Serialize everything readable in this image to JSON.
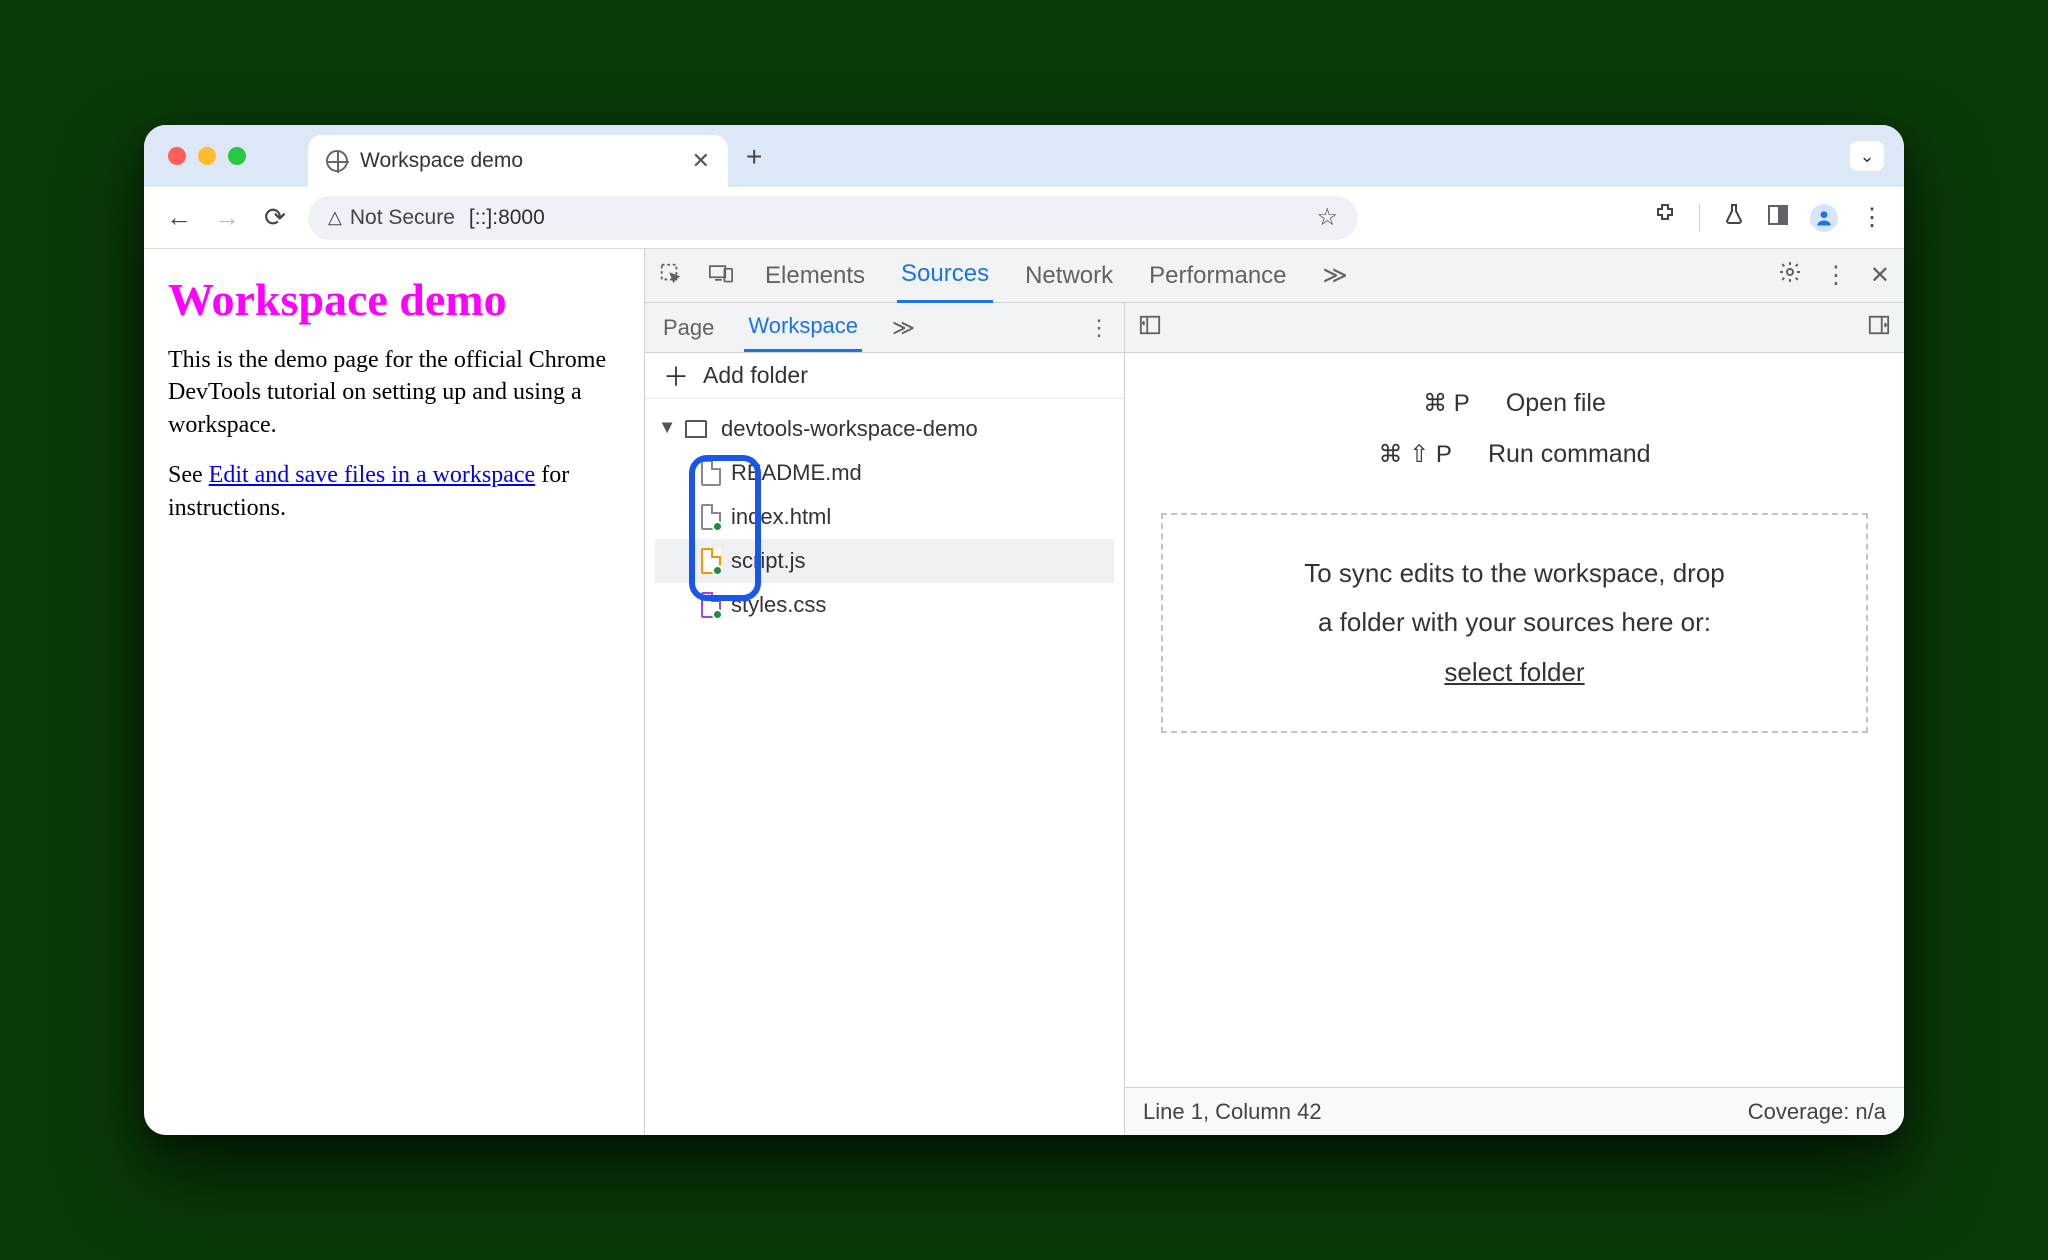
{
  "browser": {
    "tab_title": "Workspace demo",
    "new_tab_label": "+",
    "nav": {
      "back": "←",
      "forward": "→",
      "reload": "⟳"
    },
    "omnibox": {
      "not_secure_label": "Not Secure",
      "url": "[::]:8000"
    },
    "toolbar": {
      "extensions": "⧩",
      "labs": "⚗",
      "panel": "◨",
      "menu": "⋮"
    }
  },
  "page": {
    "heading": "Workspace demo",
    "p1": "This is the demo page for the official Chrome DevTools tutorial on setting up and using a workspace.",
    "p2_prefix": "See ",
    "p2_link": "Edit and save files in a workspace",
    "p2_suffix": " for instructions."
  },
  "devtools": {
    "tabs": {
      "elements": "Elements",
      "sources": "Sources",
      "network": "Network",
      "performance": "Performance",
      "more": "≫"
    },
    "sources": {
      "subtabs": {
        "page": "Page",
        "workspace": "Workspace",
        "more": "≫"
      },
      "add_folder": "Add folder",
      "tree": {
        "root": "devtools-workspace-demo",
        "files": [
          {
            "name": "README.md",
            "icon": "gray",
            "mapped": false
          },
          {
            "name": "index.html",
            "icon": "gray",
            "mapped": true
          },
          {
            "name": "script.js",
            "icon": "orange",
            "mapped": true
          },
          {
            "name": "styles.css",
            "icon": "purple",
            "mapped": true
          }
        ]
      }
    },
    "main": {
      "hint_open_keys": "⌘ P",
      "hint_open_label": "Open file",
      "hint_run_keys": "⌘ ⇧ P",
      "hint_run_label": "Run command",
      "drop_text_1": "To sync edits to the workspace, drop",
      "drop_text_2": "a folder with your sources here or:",
      "select_folder": "select folder"
    },
    "status": {
      "position": "Line 1, Column 42",
      "coverage": "Coverage: n/a"
    }
  }
}
